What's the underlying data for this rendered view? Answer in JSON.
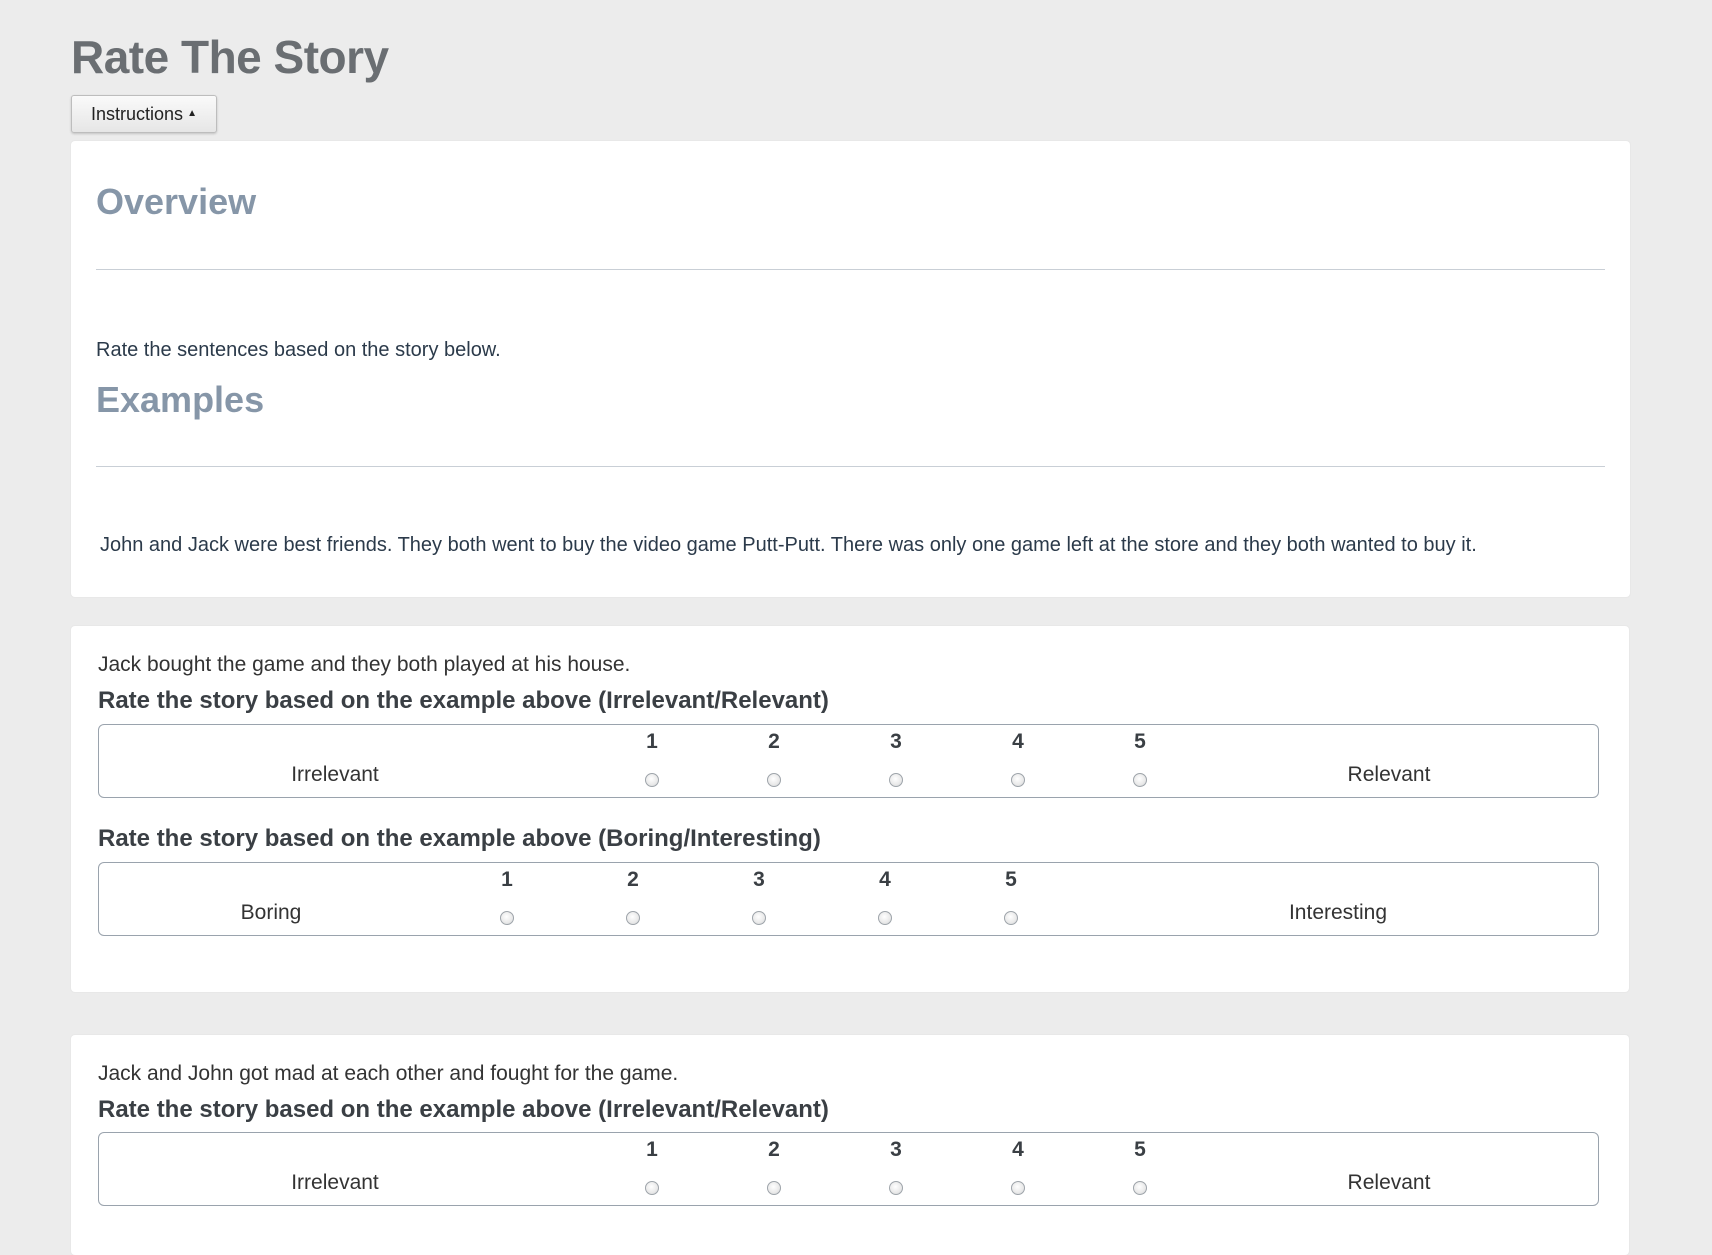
{
  "page": {
    "title": "Rate The Story"
  },
  "instructions_button": {
    "label": "Instructions"
  },
  "instructions": {
    "overview_heading": "Overview",
    "overview_text": "Rate the sentences based on the story below.",
    "examples_heading": "Examples",
    "story_text": "John and Jack were best friends. They both went to buy the video game Putt-Putt. There was only one game left at the store and they both wanted to buy it."
  },
  "questions": [
    {
      "sentence": "Jack bought the game and they both played at his house.",
      "scales": [
        {
          "label": "Rate the story based on the example above (Irrelevant/Relevant)",
          "low": "Irrelevant",
          "high": "Relevant",
          "options": [
            "1",
            "2",
            "3",
            "4",
            "5"
          ]
        },
        {
          "label": "Rate the story based on the example above (Boring/Interesting)",
          "low": "Boring",
          "high": "Interesting",
          "options": [
            "1",
            "2",
            "3",
            "4",
            "5"
          ]
        }
      ]
    },
    {
      "sentence": "Jack and John got mad at each other and fought for the game.",
      "scales": [
        {
          "label": "Rate the story based on the example above (Irrelevant/Relevant)",
          "low": "Irrelevant",
          "high": "Relevant",
          "options": [
            "1",
            "2",
            "3",
            "4",
            "5"
          ]
        }
      ]
    }
  ]
}
